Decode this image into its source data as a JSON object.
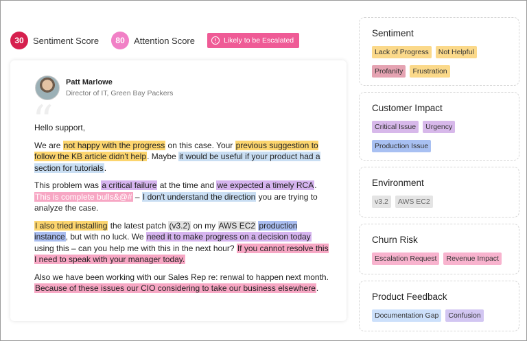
{
  "scores": {
    "sentiment": {
      "value": "30",
      "label": "Sentiment Score",
      "color": "#d6204e"
    },
    "attention": {
      "value": "80",
      "label": "Attention Score",
      "color": "#f180c6"
    },
    "escalation_badge": {
      "icon": "exclamation-circle-icon",
      "label": "Likely to be Escalated",
      "color": "#ef5b96"
    }
  },
  "email": {
    "sender_name": "Patt Marlowe",
    "sender_title": "Director of IT, Green Bay Packers",
    "greeting": "Hello support,",
    "p1": {
      "s1": "We are ",
      "h1": "not happy with the progress",
      "s2": " on this case. Your ",
      "h2": "previous suggestion to follow the KB article didn't help",
      "s3": ". Maybe ",
      "h3": "it would be useful if your product had a section for tutorials",
      "s4": "."
    },
    "p2": {
      "s1": "This problem was ",
      "h1": "a critical failure",
      "s2": " at the time and ",
      "h2": "we expected a timely RCA",
      "s3": ". ",
      "h3": "This is complete bulls&@#",
      "s4": " – ",
      "h4": "I don't understand the direction",
      "s5": " you are trying to analyze the case."
    },
    "p3": {
      "h1": "I also tried installing",
      "s1": " the latest patch ",
      "h2": "(v3.2)",
      "s2": " on my ",
      "h3": "AWS EC2",
      "s3": " ",
      "h4": "production instance",
      "s4": ", but with no luck. We ",
      "h5": "need it to make progress on a decision today",
      "s5": " using this – can you help me with this in the next hour? ",
      "h6": "If you cannot resolve this I need to speak with your manager today."
    },
    "p4": {
      "s1": "Also we have been working with our Sales Rep re: renwal to happen next month. ",
      "h1": "Because of these issues our CIO considering to take our business elsewhere",
      "s2": "."
    }
  },
  "panels": {
    "sentiment": {
      "title": "Sentiment",
      "tags": [
        "Lack of Progress",
        "Not Helpful",
        "Profanity",
        "Frustration"
      ]
    },
    "customer_impact": {
      "title": "Customer Impact",
      "tags": [
        "Critical Issue",
        "Urgency",
        "Production Issue"
      ]
    },
    "environment": {
      "title": "Environment",
      "tags": [
        "v3.2",
        "AWS EC2"
      ]
    },
    "churn_risk": {
      "title": "Churn Risk",
      "tags": [
        "Escalation Request",
        "Revenue Impact"
      ]
    },
    "product_feedback": {
      "title": "Product Feedback",
      "tags": [
        "Documentation Gap",
        "Confusion"
      ]
    }
  }
}
